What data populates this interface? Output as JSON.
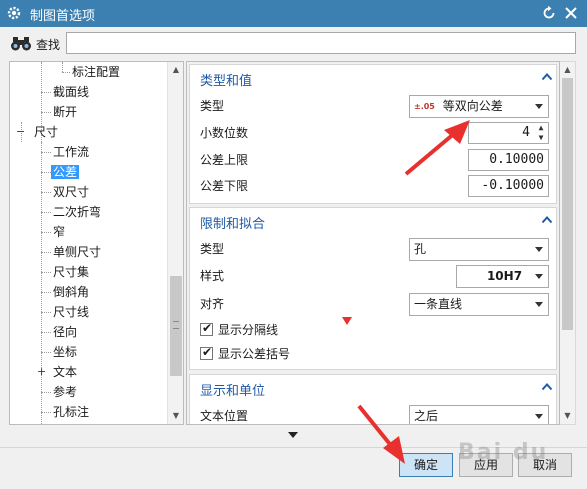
{
  "window": {
    "title": "制图首选项"
  },
  "find": {
    "label": "查找",
    "value": ""
  },
  "tree": {
    "items": [
      {
        "label": "标注配置"
      },
      {
        "label": "截面线"
      },
      {
        "label": "断开"
      },
      {
        "label": "尺寸",
        "expander": "−"
      },
      {
        "label": "工作流"
      },
      {
        "label": "公差",
        "selected": true
      },
      {
        "label": "双尺寸"
      },
      {
        "label": "二次折弯"
      },
      {
        "label": "窄"
      },
      {
        "label": "单侧尺寸"
      },
      {
        "label": "尺寸集"
      },
      {
        "label": "倒斜角"
      },
      {
        "label": "尺寸线"
      },
      {
        "label": "径向"
      },
      {
        "label": "坐标"
      },
      {
        "label": "文本",
        "expander": "+"
      },
      {
        "label": "参考"
      },
      {
        "label": "孔标注"
      }
    ]
  },
  "groups": {
    "type_value": {
      "title": "类型和值",
      "type_label": "类型",
      "type_value": "等双向公差",
      "type_icon_text": "±.05",
      "decimals_label": "小数位数",
      "decimals_value": "4",
      "upper_label": "公差上限",
      "upper_value": "0.10000",
      "lower_label": "公差下限",
      "lower_value": "-0.10000"
    },
    "limits_fits": {
      "title": "限制和拟合",
      "type_label": "类型",
      "type_value": "孔",
      "style_label": "样式",
      "style_value": "10H7",
      "align_label": "对齐",
      "align_value": "一条直线",
      "show_separator_label": "显示分隔线",
      "show_brackets_label": "显示公差括号"
    },
    "display_units": {
      "title": "显示和单位",
      "text_pos_label": "文本位置",
      "text_pos_value": "之后"
    }
  },
  "buttons": {
    "ok": "确定",
    "apply": "应用",
    "cancel": "取消"
  },
  "colors": {
    "titlebar": "#3c7fb1",
    "group_title": "#1f5aa6",
    "selection": "#3399ff",
    "annotation": "#e8312f"
  },
  "watermark": "Bai du"
}
